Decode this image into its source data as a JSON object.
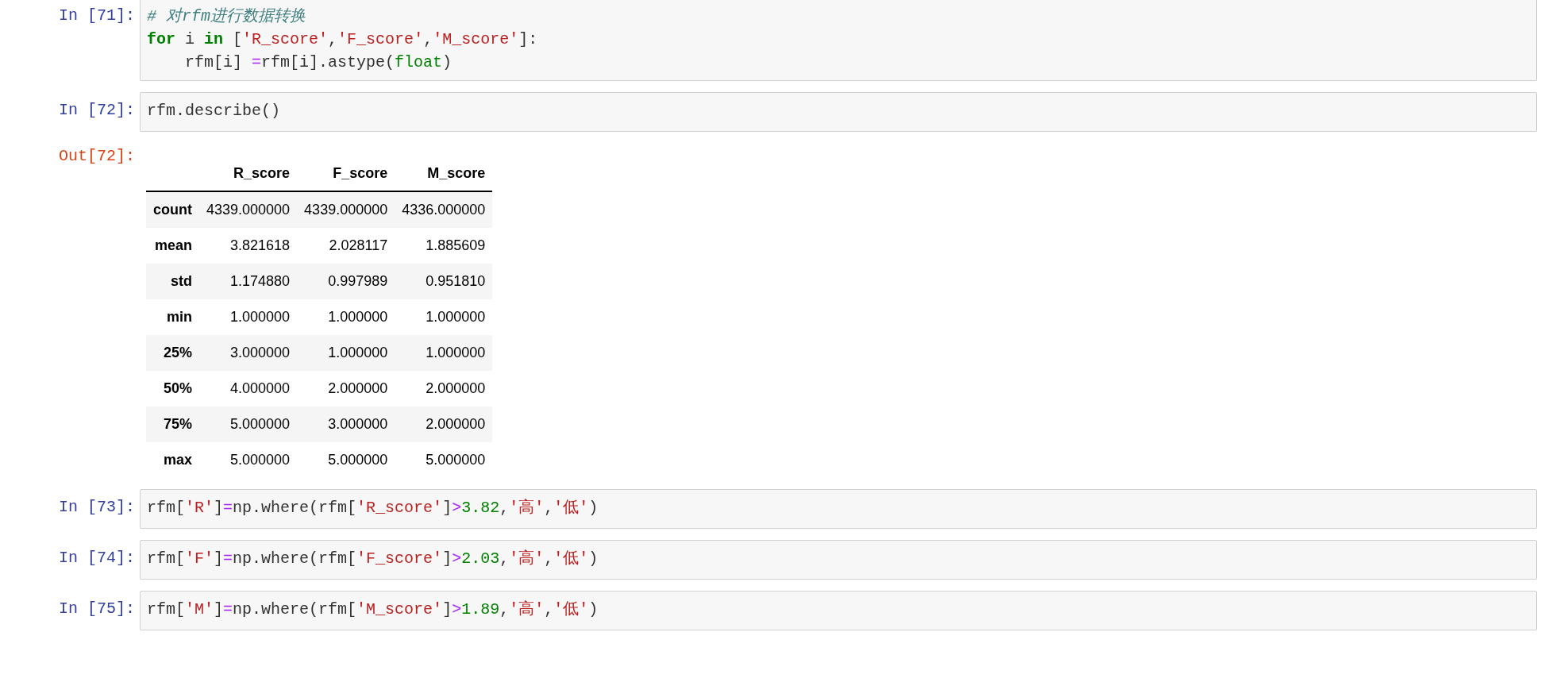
{
  "cells": [
    {
      "prompt": "In [71]:",
      "lines": [
        [
          {
            "kind": "comment",
            "text": "# 对rfm进行数据转换"
          }
        ],
        [
          {
            "kind": "keyword",
            "text": "for"
          },
          {
            "kind": "plain",
            "text": " i "
          },
          {
            "kind": "keyword",
            "text": "in"
          },
          {
            "kind": "plain",
            "text": " ["
          },
          {
            "kind": "string",
            "text": "'R_score'"
          },
          {
            "kind": "plain",
            "text": ","
          },
          {
            "kind": "string",
            "text": "'F_score'"
          },
          {
            "kind": "plain",
            "text": ","
          },
          {
            "kind": "string",
            "text": "'M_score'"
          },
          {
            "kind": "plain",
            "text": "]:"
          }
        ],
        [
          {
            "kind": "plain",
            "text": "    rfm[i] "
          },
          {
            "kind": "operator",
            "text": "="
          },
          {
            "kind": "plain",
            "text": "rfm[i].astype("
          },
          {
            "kind": "builtin",
            "text": "float"
          },
          {
            "kind": "plain",
            "text": ")"
          }
        ]
      ]
    },
    {
      "prompt": "In [72]:",
      "lines": [
        [
          {
            "kind": "plain",
            "text": "rfm.describe()"
          }
        ]
      ],
      "output": {
        "prompt": "Out[72]:",
        "columns": [
          "R_score",
          "F_score",
          "M_score"
        ],
        "rows": [
          {
            "label": "count",
            "values": [
              "4339.000000",
              "4339.000000",
              "4336.000000"
            ]
          },
          {
            "label": "mean",
            "values": [
              "3.821618",
              "2.028117",
              "1.885609"
            ]
          },
          {
            "label": "std",
            "values": [
              "1.174880",
              "0.997989",
              "0.951810"
            ]
          },
          {
            "label": "min",
            "values": [
              "1.000000",
              "1.000000",
              "1.000000"
            ]
          },
          {
            "label": "25%",
            "values": [
              "3.000000",
              "1.000000",
              "1.000000"
            ]
          },
          {
            "label": "50%",
            "values": [
              "4.000000",
              "2.000000",
              "2.000000"
            ]
          },
          {
            "label": "75%",
            "values": [
              "5.000000",
              "3.000000",
              "2.000000"
            ]
          },
          {
            "label": "max",
            "values": [
              "5.000000",
              "5.000000",
              "5.000000"
            ]
          }
        ]
      }
    },
    {
      "prompt": "In [73]:",
      "lines": [
        [
          {
            "kind": "plain",
            "text": "rfm["
          },
          {
            "kind": "string",
            "text": "'R'"
          },
          {
            "kind": "plain",
            "text": "]"
          },
          {
            "kind": "operator",
            "text": "="
          },
          {
            "kind": "plain",
            "text": "np.where(rfm["
          },
          {
            "kind": "string",
            "text": "'R_score'"
          },
          {
            "kind": "plain",
            "text": "]"
          },
          {
            "kind": "operator",
            "text": ">"
          },
          {
            "kind": "number",
            "text": "3.82"
          },
          {
            "kind": "plain",
            "text": ","
          },
          {
            "kind": "string",
            "text": "'高'"
          },
          {
            "kind": "plain",
            "text": ","
          },
          {
            "kind": "string",
            "text": "'低'"
          },
          {
            "kind": "plain",
            "text": ")"
          }
        ]
      ]
    },
    {
      "prompt": "In [74]:",
      "lines": [
        [
          {
            "kind": "plain",
            "text": "rfm["
          },
          {
            "kind": "string",
            "text": "'F'"
          },
          {
            "kind": "plain",
            "text": "]"
          },
          {
            "kind": "operator",
            "text": "="
          },
          {
            "kind": "plain",
            "text": "np.where(rfm["
          },
          {
            "kind": "string",
            "text": "'F_score'"
          },
          {
            "kind": "plain",
            "text": "]"
          },
          {
            "kind": "operator",
            "text": ">"
          },
          {
            "kind": "number",
            "text": "2.03"
          },
          {
            "kind": "plain",
            "text": ","
          },
          {
            "kind": "string",
            "text": "'高'"
          },
          {
            "kind": "plain",
            "text": ","
          },
          {
            "kind": "string",
            "text": "'低'"
          },
          {
            "kind": "plain",
            "text": ")"
          }
        ]
      ]
    },
    {
      "prompt": "In [75]:",
      "lines": [
        [
          {
            "kind": "plain",
            "text": "rfm["
          },
          {
            "kind": "string",
            "text": "'M'"
          },
          {
            "kind": "plain",
            "text": "]"
          },
          {
            "kind": "operator",
            "text": "="
          },
          {
            "kind": "plain",
            "text": "np.where(rfm["
          },
          {
            "kind": "string",
            "text": "'M_score'"
          },
          {
            "kind": "plain",
            "text": "]"
          },
          {
            "kind": "operator",
            "text": ">"
          },
          {
            "kind": "number",
            "text": "1.89"
          },
          {
            "kind": "plain",
            "text": ","
          },
          {
            "kind": "string",
            "text": "'高'"
          },
          {
            "kind": "plain",
            "text": ","
          },
          {
            "kind": "string",
            "text": "'低'"
          },
          {
            "kind": "plain",
            "text": ")"
          }
        ]
      ]
    }
  ]
}
